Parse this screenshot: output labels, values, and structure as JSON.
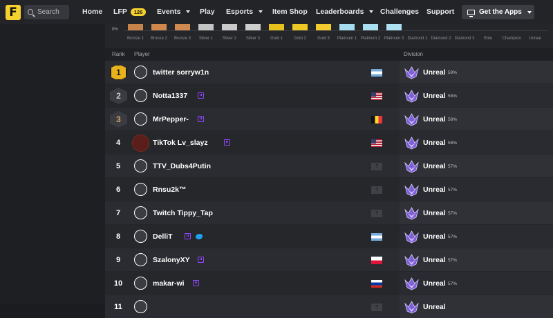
{
  "nav": {
    "logo_letter": "F",
    "search_placeholder": "Search",
    "items": [
      {
        "label": "Home"
      },
      {
        "label": "LFP",
        "badge": "126"
      },
      {
        "label": "Events"
      },
      {
        "label": "Play"
      },
      {
        "label": "Esports"
      },
      {
        "label": "Item Shop"
      },
      {
        "label": "Leaderboards"
      },
      {
        "label": "Challenges"
      },
      {
        "label": "Support"
      }
    ],
    "get_apps_label": "Get the Apps"
  },
  "distribution": {
    "zero_label": "0%",
    "tiers": [
      {
        "label": "Bronze 1",
        "color": "#c7834a"
      },
      {
        "label": "Bronze 2",
        "color": "#d0874c"
      },
      {
        "label": "Bronze 3",
        "color": "#d08a50"
      },
      {
        "label": "Silver 1",
        "color": "#c4c4c4"
      },
      {
        "label": "Silver 2",
        "color": "#c9c9c9"
      },
      {
        "label": "Silver 3",
        "color": "#cecece"
      },
      {
        "label": "Gold 1",
        "color": "#e8c21c"
      },
      {
        "label": "Gold 2",
        "color": "#eec824"
      },
      {
        "label": "Gold 3",
        "color": "#f2cc2e"
      },
      {
        "label": "Platinum 1",
        "color": "#a6dcef"
      },
      {
        "label": "Platinum 2",
        "color": "#a9dff1"
      },
      {
        "label": "Platinum 3",
        "color": "#ade1f2"
      },
      {
        "label": "Diamond 1",
        "color": "#5a6fd8"
      },
      {
        "label": "Diamond 2",
        "color": "#5d72da"
      },
      {
        "label": "Diamond 3",
        "color": "#6075dc"
      },
      {
        "label": "Elite",
        "color": "#c9d2de"
      },
      {
        "label": "Champion",
        "color": "#e07b3a"
      },
      {
        "label": "Unreal",
        "color": "#b18cf5"
      }
    ]
  },
  "table": {
    "headers": {
      "rank": "Rank",
      "player": "Player",
      "division": "Division"
    },
    "rows": [
      {
        "rank": "1",
        "name": "twitter sorryw1n",
        "twitch": false,
        "twitter": false,
        "flag": "argentina",
        "division": "Unreal",
        "pct": "59%"
      },
      {
        "rank": "2",
        "name": "Notta1337",
        "twitch": true,
        "twitter": false,
        "flag": "usa",
        "division": "Unreal",
        "pct": "58%"
      },
      {
        "rank": "3",
        "name": "MrPepper-",
        "twitch": true,
        "twitter": false,
        "flag": "belgium",
        "division": "Unreal",
        "pct": "58%"
      },
      {
        "rank": "4",
        "name": "TikTok Lv_slayz",
        "twitch": true,
        "twitter": false,
        "flag": "usa",
        "division": "Unreal",
        "pct": "58%"
      },
      {
        "rank": "5",
        "name": "TTV_Dubs4Putin",
        "twitch": false,
        "twitter": false,
        "flag": "unknown",
        "division": "Unreal",
        "pct": "57%"
      },
      {
        "rank": "6",
        "name": "Rnsu2k™",
        "twitch": false,
        "twitter": false,
        "flag": "unknown",
        "division": "Unreal",
        "pct": "57%"
      },
      {
        "rank": "7",
        "name": "Twitch Tippy_Tap",
        "twitch": false,
        "twitter": false,
        "flag": "unknown",
        "division": "Unreal",
        "pct": "57%"
      },
      {
        "rank": "8",
        "name": "DelliT",
        "twitch": true,
        "twitter": true,
        "flag": "argentina",
        "division": "Unreal",
        "pct": "57%"
      },
      {
        "rank": "9",
        "name": "SzalonyXY",
        "twitch": true,
        "twitter": false,
        "flag": "poland",
        "division": "Unreal",
        "pct": "57%"
      },
      {
        "rank": "10",
        "name": "makar-wi",
        "twitch": true,
        "twitter": false,
        "flag": "russia",
        "division": "Unreal",
        "pct": "57%"
      },
      {
        "rank": "11",
        "name": "",
        "twitch": false,
        "twitter": false,
        "flag": "unknown",
        "division": "Unreal",
        "pct": ""
      }
    ]
  },
  "colors": {
    "accent": "#f5d130",
    "twitch": "#9146ff",
    "twitter": "#1da1f2",
    "gold_rank": "#e8b21c",
    "unreal": "#b18cf5"
  }
}
